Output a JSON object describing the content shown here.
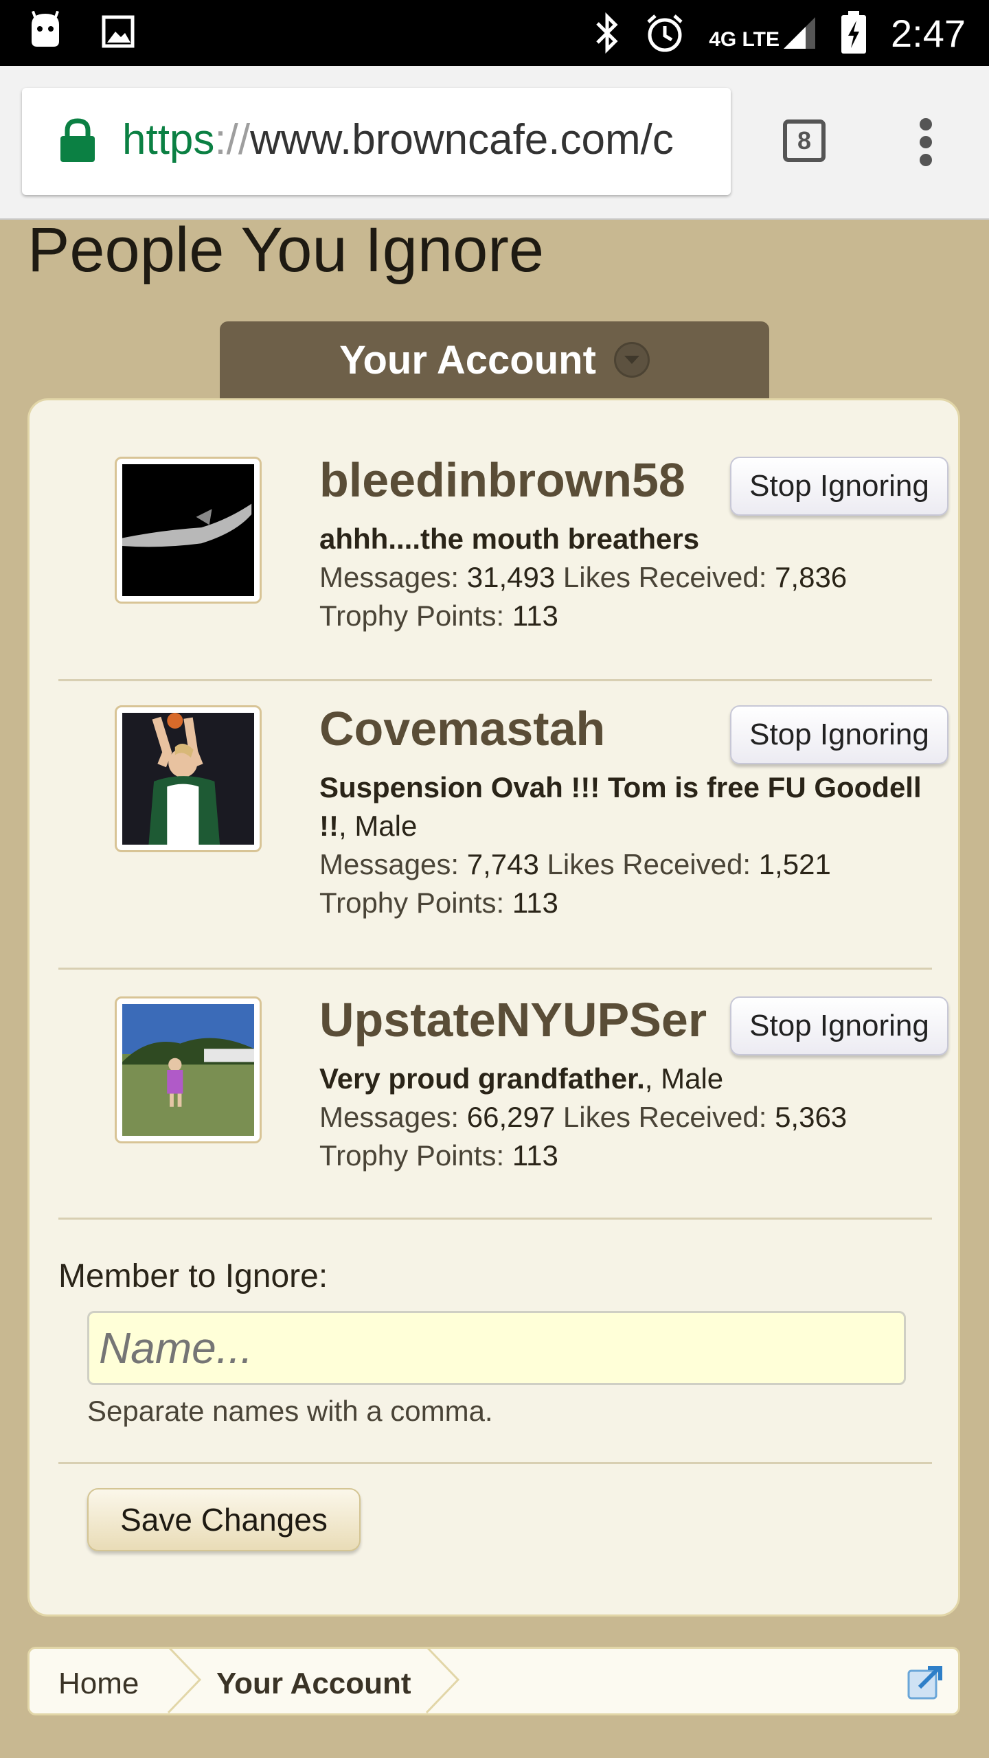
{
  "status_bar": {
    "time": "2:47",
    "network": "4G LTE",
    "icons": [
      "android-icon",
      "image-icon",
      "bluetooth-icon",
      "alarm-icon",
      "signal-icon",
      "battery-charging-icon"
    ]
  },
  "browser": {
    "url_scheme": "https",
    "url_sep": "://",
    "url_rest": "www.browncafe.com/c",
    "tab_count": "8"
  },
  "page": {
    "title": "People You Ignore",
    "account_tab": "Your Account"
  },
  "members": [
    {
      "name": "bleedinbrown58",
      "title": "ahhh....the mouth breathers",
      "gender": "",
      "messages_label": "Messages:",
      "messages": "31,493",
      "likes_label": "Likes Received:",
      "likes": "7,836",
      "trophy_label": "Trophy Points:",
      "trophy": "113",
      "button": "Stop Ignoring"
    },
    {
      "name": "Covemastah",
      "title": "Suspension Ovah !!! Tom is free FU Goodell !!",
      "gender": ", Male",
      "messages_label": "Messages:",
      "messages": "7,743",
      "likes_label": "Likes Received:",
      "likes": "1,521",
      "trophy_label": "Trophy Points:",
      "trophy": "113",
      "button": "Stop Ignoring"
    },
    {
      "name": "UpstateNYUPSer",
      "title": "Very proud grandfather.",
      "gender": ", Male",
      "messages_label": "Messages:",
      "messages": "66,297",
      "likes_label": "Likes Received:",
      "likes": "5,363",
      "trophy_label": "Trophy Points:",
      "trophy": "113",
      "button": "Stop Ignoring"
    }
  ],
  "form": {
    "label": "Member to Ignore:",
    "placeholder": "Name...",
    "hint": "Separate names with a comma.",
    "save": "Save Changes"
  },
  "breadcrumb": {
    "home": "Home",
    "current": "Your Account"
  },
  "colors": {
    "page_bg": "#c8b891",
    "tab_bg": "#6e6049",
    "username": "#5a4d37",
    "url_green": "#0b8043"
  }
}
